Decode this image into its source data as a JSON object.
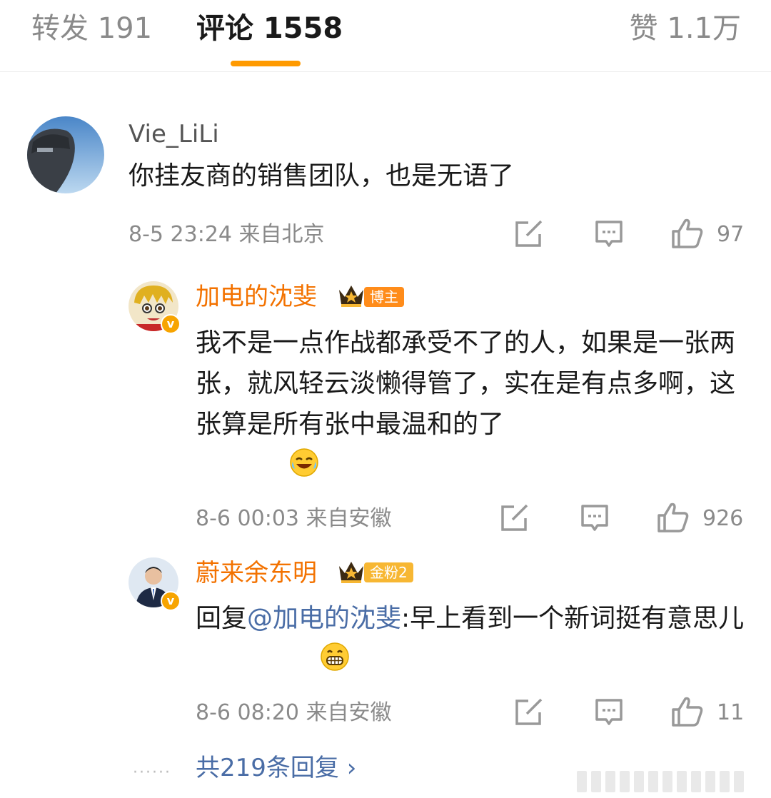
{
  "tabs": {
    "repost": "转发 191",
    "comments": "评论 1558",
    "likes": "赞 1.1万"
  },
  "comments": [
    {
      "user": "Vie_LiLi",
      "text": "你挂友商的销售团队，也是无语了",
      "meta": "8-5 23:24 来自北京",
      "likes": "97"
    },
    {
      "user": "加电的沈斐",
      "tag": "博主",
      "text": "我不是一点作战都承受不了的人，如果是一张两张，就风轻云淡懒得管了，实在是有点多啊，这张算是所有张中最温和的了",
      "meta": "8-6 00:03 来自安徽",
      "likes": "926"
    },
    {
      "user": "蔚来余东明",
      "tag": "金粉2",
      "reply_prefix": "回复",
      "mention": "@加电的沈斐",
      "reply_text": ":早上看到一个新词挺有意思儿",
      "meta": "8-6 08:20 来自安徽",
      "likes": "11"
    }
  ],
  "more_replies": "共219条回复 ›",
  "icons": [
    "edit-icon",
    "comment-icon",
    "thumbs-up-icon",
    "laugh-cry-emoji",
    "grin-emoji",
    "crown-icon",
    "verified-v-icon",
    "chevron-right-icon"
  ],
  "colors": {
    "accent": "#ff9a00",
    "vip_name": "#f37200",
    "link": "#4a6da6",
    "muted": "#8a8a8a"
  }
}
